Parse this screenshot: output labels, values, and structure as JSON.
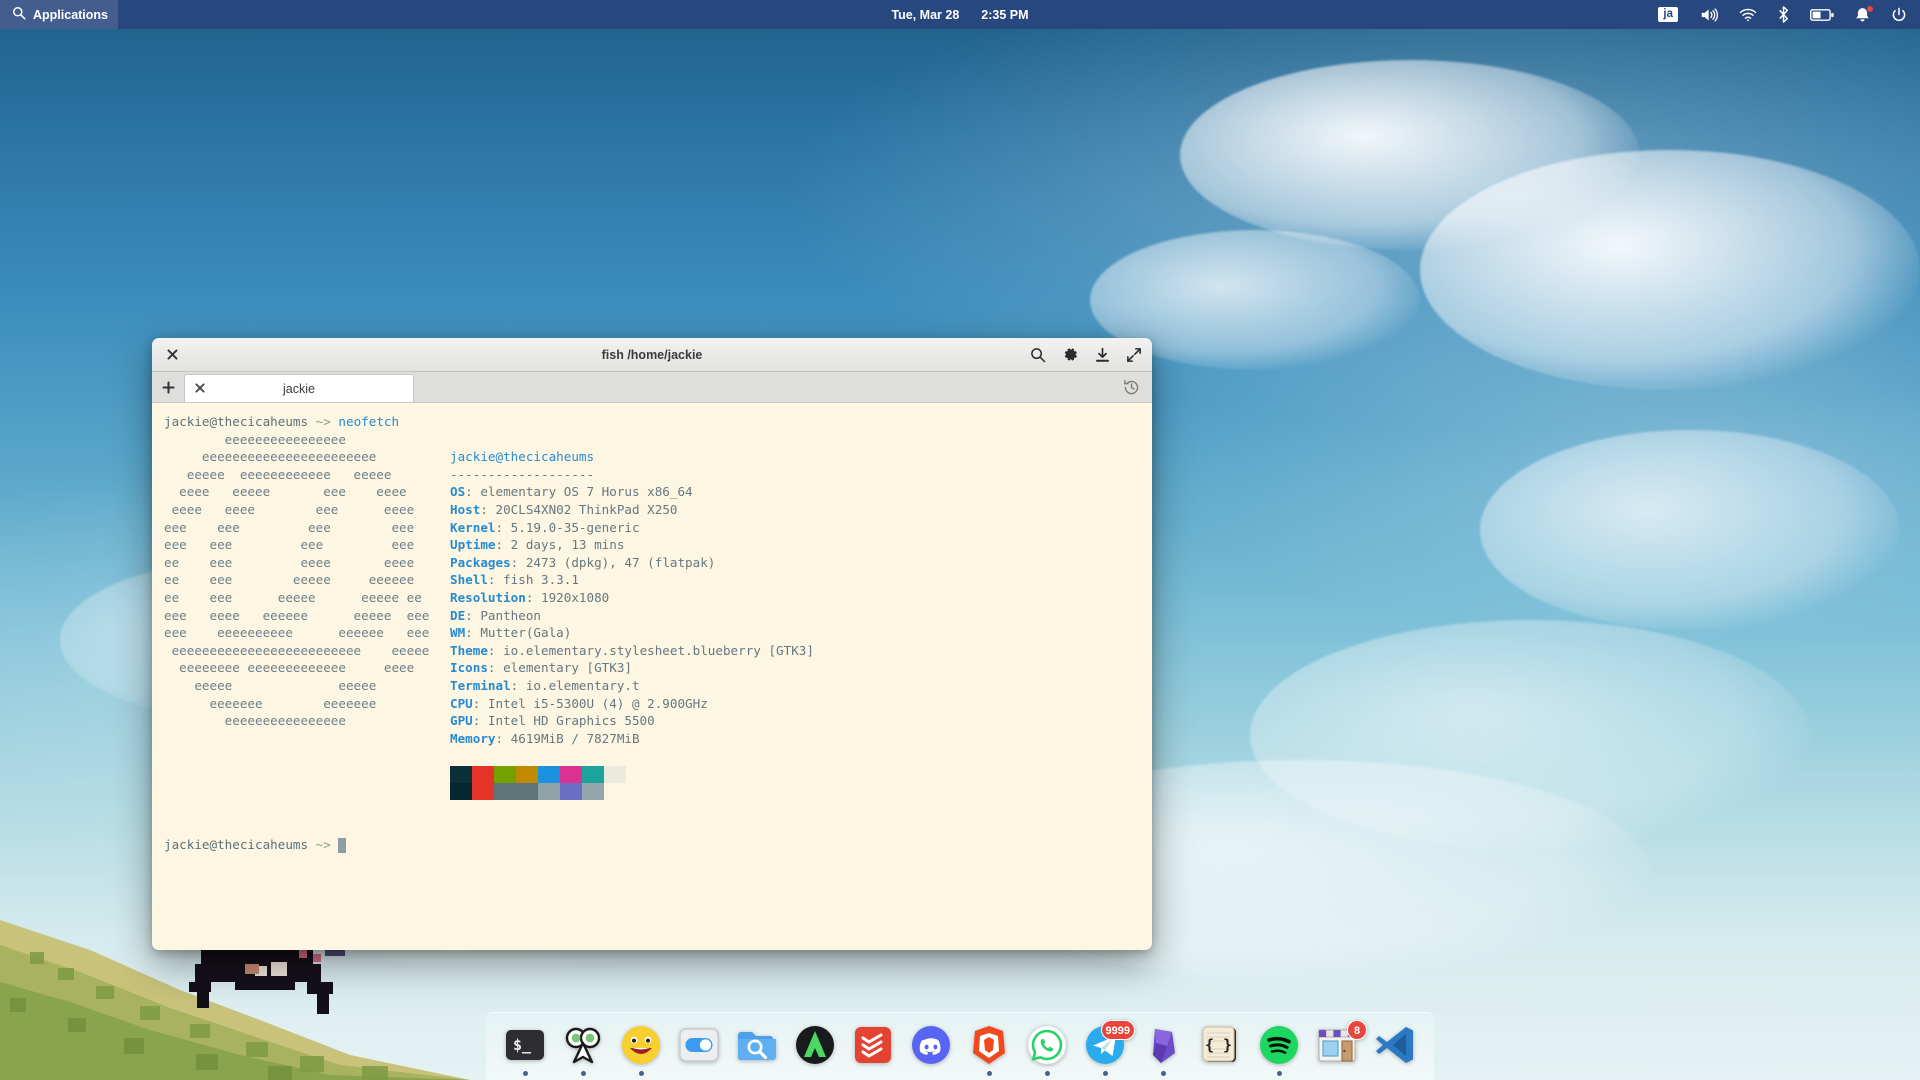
{
  "panel": {
    "applications_label": "Applications",
    "applications_icon": "search-icon",
    "date": "Tue, Mar 28",
    "time": "2:35 PM",
    "tray": {
      "keyboard_layout": "ja",
      "volume_icon": "volume-high-icon",
      "wifi_icon": "wifi-icon",
      "bluetooth_icon": "bluetooth-icon",
      "battery_icon": "battery-half-icon",
      "notifications_icon": "bell-icon",
      "power_icon": "power-icon"
    },
    "colors": {
      "background": "#28477f",
      "foreground": "#ffffff",
      "notification_dot": "#e8453c"
    }
  },
  "terminal": {
    "title": "fish /home/jackie",
    "close_icon": "close-icon",
    "titlebar_actions": [
      {
        "name": "search-icon",
        "label": "Search"
      },
      {
        "name": "gear-icon",
        "label": "Settings"
      },
      {
        "name": "download-icon",
        "label": "Save Contents"
      },
      {
        "name": "fullscreen-icon",
        "label": "Fullscreen"
      }
    ],
    "tabs": {
      "add_label": "+",
      "add_icon": "plus-icon",
      "history_icon": "history-icon",
      "items": [
        {
          "label": "jackie",
          "close_icon": "close-icon",
          "active": true
        }
      ]
    },
    "colors": {
      "background": "#fdf6e3",
      "foreground": "#5b7178",
      "accent": "#268bd2"
    },
    "command_line": {
      "prompt": "jackie@thecicaheums",
      "arrow": "~>",
      "command": "neofetch"
    },
    "ascii_logo": [
      "        eeeeeeeeeeeeeeee",
      "     eeeeeeeeeeeeeeeeeeeeeee",
      "   eeeee  eeeeeeeeeeee   eeeee",
      "  eeee   eeeee       eee    eeee",
      " eeee   eeee        eee      eeee",
      "eee    eee         eee        eee",
      "eee   eee         eee         eee",
      "ee    eee         eeee       eeee",
      "ee    eee        eeeee     eeeeee",
      "ee    eee      eeeee      eeeee ee",
      "eee   eeee   eeeeee      eeeee  eee",
      "eee    eeeeeeeeee      eeeeee   eee",
      " eeeeeeeeeeeeeeeeeeeeeeeee    eeeee",
      "  eeeeeeee eeeeeeeeeeeee     eeee",
      "    eeeee              eeeee",
      "      eeeeeee        eeeeeee",
      "        eeeeeeeeeeeeeeee"
    ],
    "neofetch": {
      "user_host": "jackie@thecicaheums",
      "separator": "-------------------",
      "fields": [
        {
          "key": "OS",
          "value": "elementary OS 7 Horus x86_64"
        },
        {
          "key": "Host",
          "value": "20CLS4XN02 ThinkPad X250"
        },
        {
          "key": "Kernel",
          "value": "5.19.0-35-generic"
        },
        {
          "key": "Uptime",
          "value": "2 days, 13 mins"
        },
        {
          "key": "Packages",
          "value": "2473 (dpkg), 47 (flatpak)"
        },
        {
          "key": "Shell",
          "value": "fish 3.3.1"
        },
        {
          "key": "Resolution",
          "value": "1920x1080"
        },
        {
          "key": "DE",
          "value": "Pantheon"
        },
        {
          "key": "WM",
          "value": "Mutter(Gala)"
        },
        {
          "key": "Theme",
          "value": "io.elementary.stylesheet.blueberry [GTK3]"
        },
        {
          "key": "Icons",
          "value": "elementary [GTK3]"
        },
        {
          "key": "Terminal",
          "value": "io.elementary.t"
        },
        {
          "key": "CPU",
          "value": "Intel i5-5300U (4) @ 2.900GHz"
        },
        {
          "key": "GPU",
          "value": "Intel HD Graphics 5500"
        },
        {
          "key": "Memory",
          "value": "4619MiB / 7827MiB"
        }
      ],
      "palette_row1": [
        "#0b3038",
        "#e63329",
        "#74a000",
        "#c08a00",
        "#1b92df",
        "#db3391",
        "#1ba39c",
        "#eceade"
      ],
      "palette_row2": [
        "#042730",
        "#e63329",
        "#5f7479",
        "#5f7479",
        "#8fa3a8",
        "#6a6ec4",
        "#93a7ac",
        "#fdf6e3"
      ]
    },
    "final_prompt": {
      "prompt": "jackie@thecicaheums",
      "arrow": "~>",
      "cursor": "block-cursor"
    }
  },
  "dock": {
    "items": [
      {
        "name": "terminal",
        "label": "Terminal",
        "icon": "terminal-icon",
        "running": true,
        "badge": null
      },
      {
        "name": "owl-app",
        "label": "Owl",
        "icon": "owl-icon",
        "running": true,
        "badge": null
      },
      {
        "name": "emoji",
        "label": "Emoji",
        "icon": "emoji-icon",
        "running": true,
        "badge": null
      },
      {
        "name": "settings",
        "label": "Settings",
        "icon": "toggle-icon",
        "running": false,
        "badge": null
      },
      {
        "name": "files",
        "label": "Files",
        "icon": "folder-search-icon",
        "running": false,
        "badge": null
      },
      {
        "name": "nordvpn",
        "label": "NordVPN",
        "icon": "nordvpn-icon",
        "running": false,
        "badge": null
      },
      {
        "name": "todoist",
        "label": "Todoist",
        "icon": "todoist-icon",
        "running": false,
        "badge": null
      },
      {
        "name": "discord",
        "label": "Discord",
        "icon": "discord-icon",
        "running": false,
        "badge": null
      },
      {
        "name": "brave",
        "label": "Brave",
        "icon": "brave-icon",
        "running": true,
        "badge": null
      },
      {
        "name": "whatsapp",
        "label": "WhatsApp",
        "icon": "whatsapp-icon",
        "running": true,
        "badge": null
      },
      {
        "name": "telegram",
        "label": "Telegram",
        "icon": "telegram-icon",
        "running": true,
        "badge": "9999"
      },
      {
        "name": "gem-app",
        "label": "Gem",
        "icon": "gem-icon",
        "running": true,
        "badge": null
      },
      {
        "name": "code-notes",
        "label": "Code Notes",
        "icon": "braces-icon",
        "running": false,
        "badge": null
      },
      {
        "name": "spotify",
        "label": "Spotify",
        "icon": "spotify-icon",
        "running": true,
        "badge": null
      },
      {
        "name": "appcenter",
        "label": "AppCenter",
        "icon": "appcenter-icon",
        "running": false,
        "badge": "8"
      },
      {
        "name": "vscode",
        "label": "VS Code",
        "icon": "vscode-icon",
        "running": false,
        "badge": null
      }
    ]
  }
}
